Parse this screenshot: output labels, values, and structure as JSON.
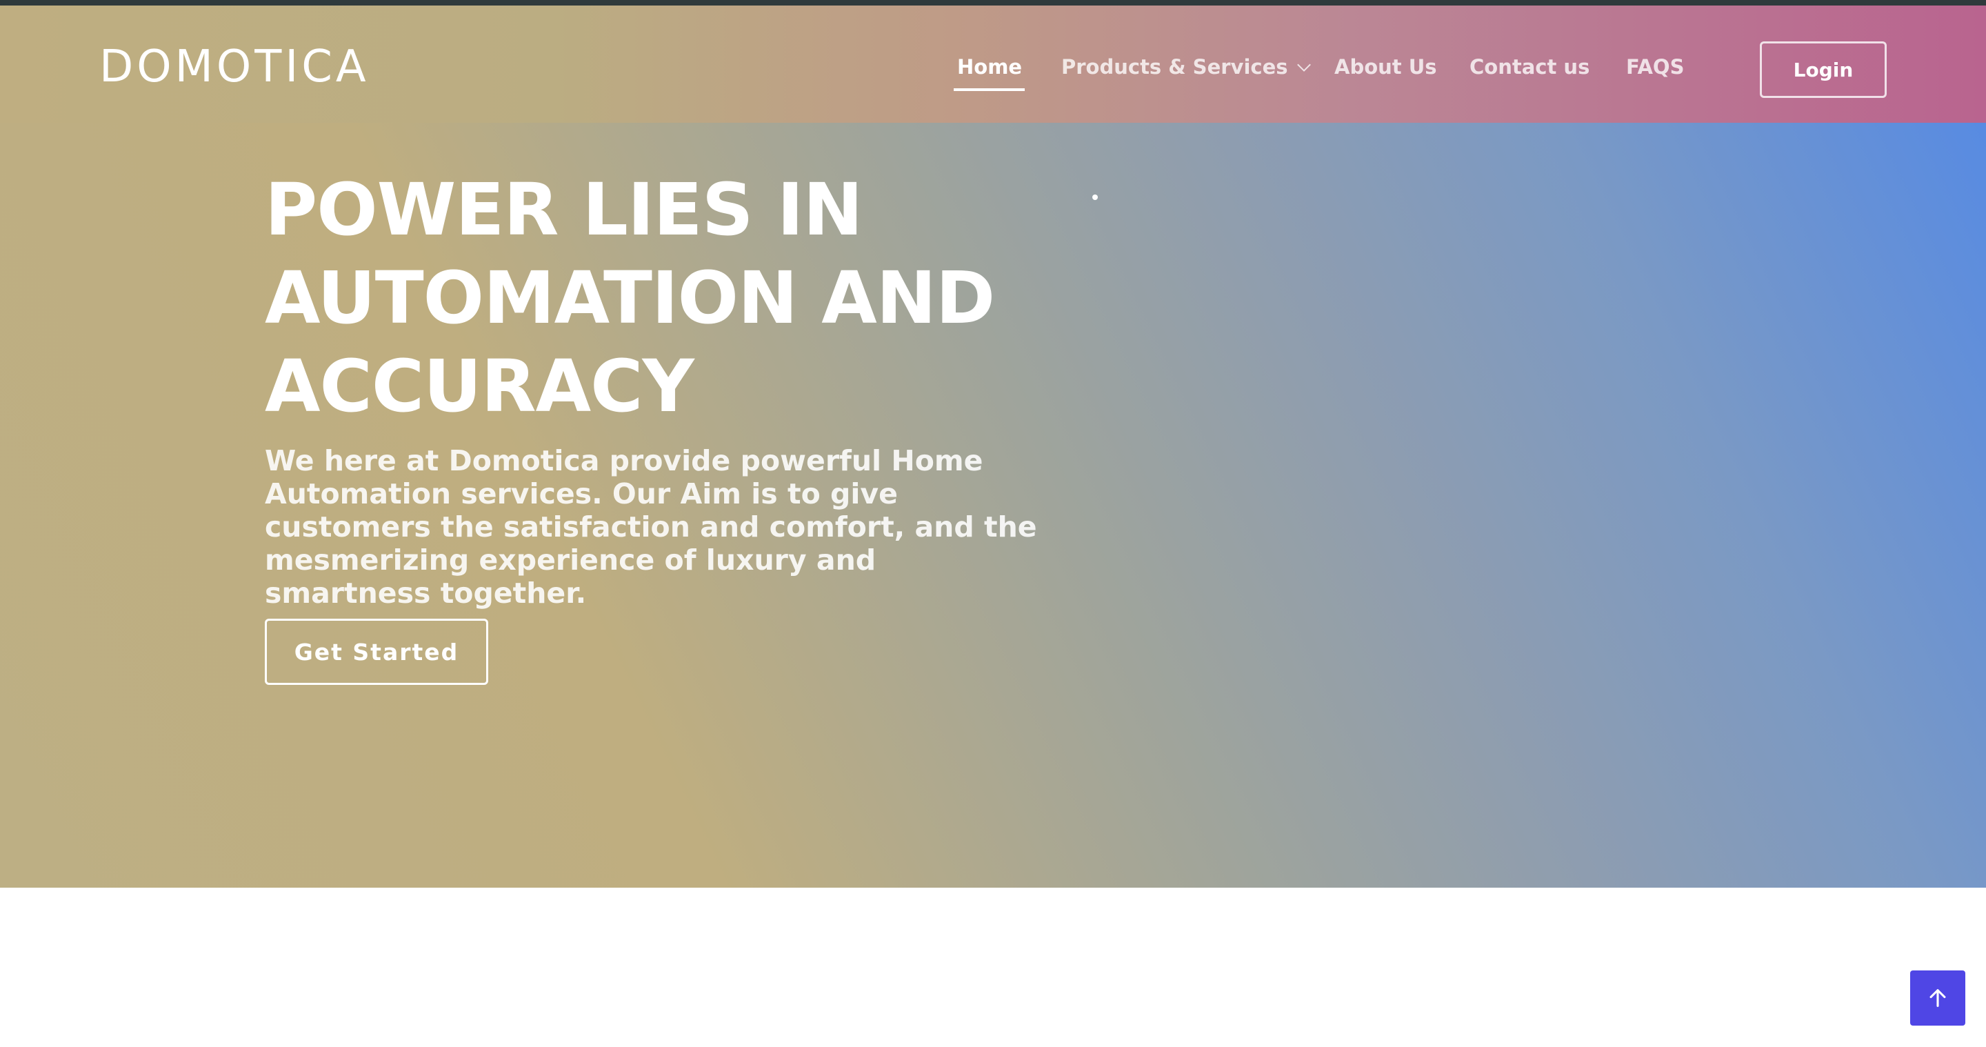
{
  "brand": {
    "logo_text": "DOMOTICA"
  },
  "nav": {
    "items": [
      {
        "label": "Home",
        "active": true
      },
      {
        "label": "Products & Services",
        "active": false,
        "has_dropdown": true
      },
      {
        "label": "About Us",
        "active": false
      },
      {
        "label": "Contact us",
        "active": false
      },
      {
        "label": "FAQS",
        "active": false
      }
    ],
    "login_label": "Login"
  },
  "hero": {
    "title": "POWER LIES IN AUTOMATION AND ACCURACY",
    "description": "We here at Domotica provide powerful Home Automation services. Our Aim is to give customers the satisfaction and comfort, and the mesmerizing experience of luxury and smartness together.",
    "cta_label": "Get Started"
  },
  "icons": {
    "dropdown": "chevron-down-icon",
    "back_to_top": "arrow-up-icon"
  },
  "colors": {
    "accent": "#4f46e5",
    "text_on_hero": "#ffffff"
  }
}
